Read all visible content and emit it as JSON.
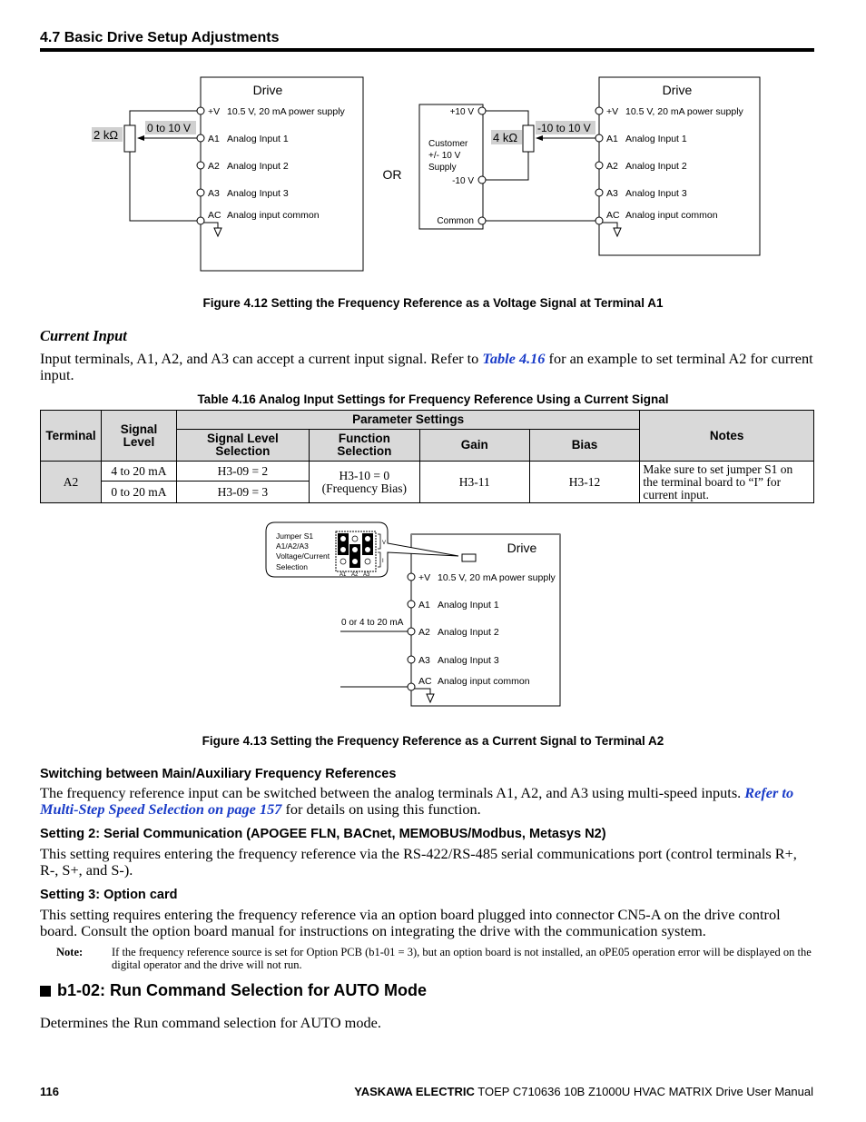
{
  "header": {
    "section_title": "4.7 Basic Drive Setup Adjustments"
  },
  "figure_4_12": {
    "caption": "Figure 4.12  Setting the Frequency Reference as a Voltage Signal at Terminal A1",
    "left_diagram": {
      "drive_label": "Drive",
      "resistor_label": "2 kΩ",
      "signal_label": "0 to 10 V",
      "terminals": [
        {
          "id": "+V",
          "desc": "10.5 V, 20 mA power supply"
        },
        {
          "id": "A1",
          "desc": "Analog Input 1"
        },
        {
          "id": "A2",
          "desc": "Analog Input 2"
        },
        {
          "id": "A3",
          "desc": "Analog Input 3"
        },
        {
          "id": "AC",
          "desc": "Analog input common"
        }
      ]
    },
    "or_label": "OR",
    "right_diagram": {
      "drive_label": "Drive",
      "resistor_label": "4 kΩ",
      "signal_label": "-10 to 10 V",
      "supply": {
        "pos_label": "+10 V",
        "neg_label": "-10 V",
        "common_label": "Common",
        "name_lines": [
          "Customer",
          "+/- 10 V",
          "Supply"
        ]
      },
      "terminals": [
        {
          "id": "+V",
          "desc": "10.5 V, 20 mA power supply"
        },
        {
          "id": "A1",
          "desc": "Analog Input 1"
        },
        {
          "id": "A2",
          "desc": "Analog Input 2"
        },
        {
          "id": "A3",
          "desc": "Analog Input 3"
        },
        {
          "id": "AC",
          "desc": "Analog input common"
        }
      ]
    }
  },
  "current_input": {
    "heading": "Current Input",
    "para_before_link": "Input terminals, A1, A2, and A3 can accept a current input signal. Refer to ",
    "link": "Table 4.16",
    "para_after_link": " for an example to set terminal A2 for current input."
  },
  "table_4_16": {
    "caption": "Table 4.16  Analog Input Settings for Frequency Reference Using a Current Signal",
    "headers": {
      "terminal": "Terminal",
      "signal_level": "Signal Level",
      "parameter_settings": "Parameter Settings",
      "signal_level_selection": "Signal Level Selection",
      "function_selection": "Function Selection",
      "gain": "Gain",
      "bias": "Bias",
      "notes": "Notes"
    },
    "rows": [
      {
        "terminal": "A2",
        "signal_level": "4 to 20 mA",
        "selection": "H3-09 = 2"
      },
      {
        "signal_level": "0 to 20 mA",
        "selection": "H3-09 = 3"
      }
    ],
    "function_selection": "H3-10 = 0",
    "function_selection_note": "(Frequency Bias)",
    "gain": "H3-11",
    "bias": "H3-12",
    "notes": "Make sure to set jumper S1 on the terminal board to “I” for current input."
  },
  "figure_4_13": {
    "caption": "Figure 4.13  Setting the Frequency Reference as a Current Signal to Terminal A2",
    "drive_label": "Drive",
    "callout_lines": [
      "Jumper S1",
      "A1/A2/A3",
      "Voltage/Current",
      "Selection"
    ],
    "jumper_columns": [
      "A1",
      "A2",
      "A3"
    ],
    "jumper_side_labels": [
      "V",
      "I"
    ],
    "signal_label": "0 or 4 to 20 mA",
    "terminals": [
      {
        "id": "+V",
        "desc": "10.5 V, 20 mA power supply"
      },
      {
        "id": "A1",
        "desc": "Analog Input 1"
      },
      {
        "id": "A2",
        "desc": "Analog Input 2"
      },
      {
        "id": "A3",
        "desc": "Analog Input 3"
      },
      {
        "id": "AC",
        "desc": "Analog input common"
      }
    ]
  },
  "switching": {
    "heading": "Switching between Main/Auxiliary Frequency References",
    "para_before_link": "The frequency reference input can be switched between the analog terminals A1, A2, and A3 using multi-speed inputs. ",
    "link": "Refer to Multi-Step Speed Selection on page 157",
    "para_after_link": " for details on using this function."
  },
  "setting2": {
    "heading": "Setting 2: Serial Communication (APOGEE FLN, BACnet, MEMOBUS/Modbus, Metasys N2)",
    "para": "This setting requires entering the frequency reference via the RS-422/RS-485 serial communications port (control terminals R+, R-, S+, and S-)."
  },
  "setting3": {
    "heading": "Setting 3: Option card",
    "para": "This setting requires entering the frequency reference via an option board plugged into connector CN5-A on the drive control board. Consult the option board manual for instructions on integrating the drive with the communication system.",
    "note_label": "Note:",
    "note_text": "If the frequency reference source is set for Option PCB (b1-01 = 3), but an option board is not installed, an oPE05 operation error will be displayed on the digital operator and the drive will not run."
  },
  "b1_02": {
    "heading": "b1-02: Run Command Selection for AUTO Mode",
    "para": "Determines the Run command selection for AUTO mode."
  },
  "footer": {
    "page_number": "116",
    "brand": "YASKAWA ELECTRIC",
    "doc_title": " TOEP C710636 10B Z1000U HVAC MATRIX Drive User Manual"
  }
}
